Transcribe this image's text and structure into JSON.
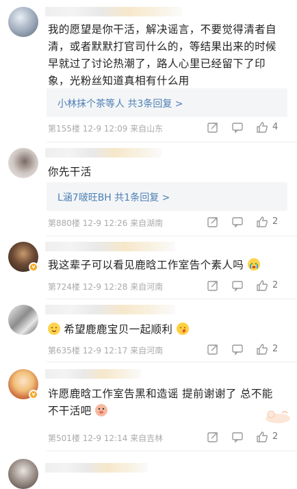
{
  "comments": [
    {
      "text": "我的愿望是你干活，解决谣言，不要觉得清者自清，或者默默打官司什么的，等结果出来的时候早就过了讨论热潮了，路人心里已经留下了印象，光粉丝知道真相有什么用",
      "reply": "小林抹个茶等人  共3条回复 >",
      "meta": "第155楼  12-9 12:09  来自山东",
      "likes": "4"
    },
    {
      "text": "你先干活",
      "reply": "L涵7啵旺BH  共1条回复 >",
      "meta": "第880楼  12-9 12:26  来自湖南",
      "likes": "2"
    },
    {
      "text": "我这辈子可以看见鹿晗工作室告个素人吗",
      "meta": "第724楼  12-9 12:28  来自河南",
      "likes": "2"
    },
    {
      "text": "希望鹿鹿宝贝一起顺利",
      "meta": "第635楼  12-9 12:17  来自河南",
      "likes": "2"
    },
    {
      "text": "许愿鹿晗工作室告黑和造谣 提前谢谢了 总不能不干活吧",
      "meta": "第501楼  12-9 12:14  来自吉林",
      "likes": "2"
    }
  ],
  "colors": {
    "link": "#4b7fb4",
    "meta": "#aaaaaa",
    "reply_bg": "#f4f5f7",
    "vip": "#f5a623"
  },
  "icons": [
    "share-icon",
    "comment-icon",
    "like-icon",
    "smile-emoji",
    "cry-emoji",
    "kiss-emoji",
    "pig-emoji"
  ]
}
